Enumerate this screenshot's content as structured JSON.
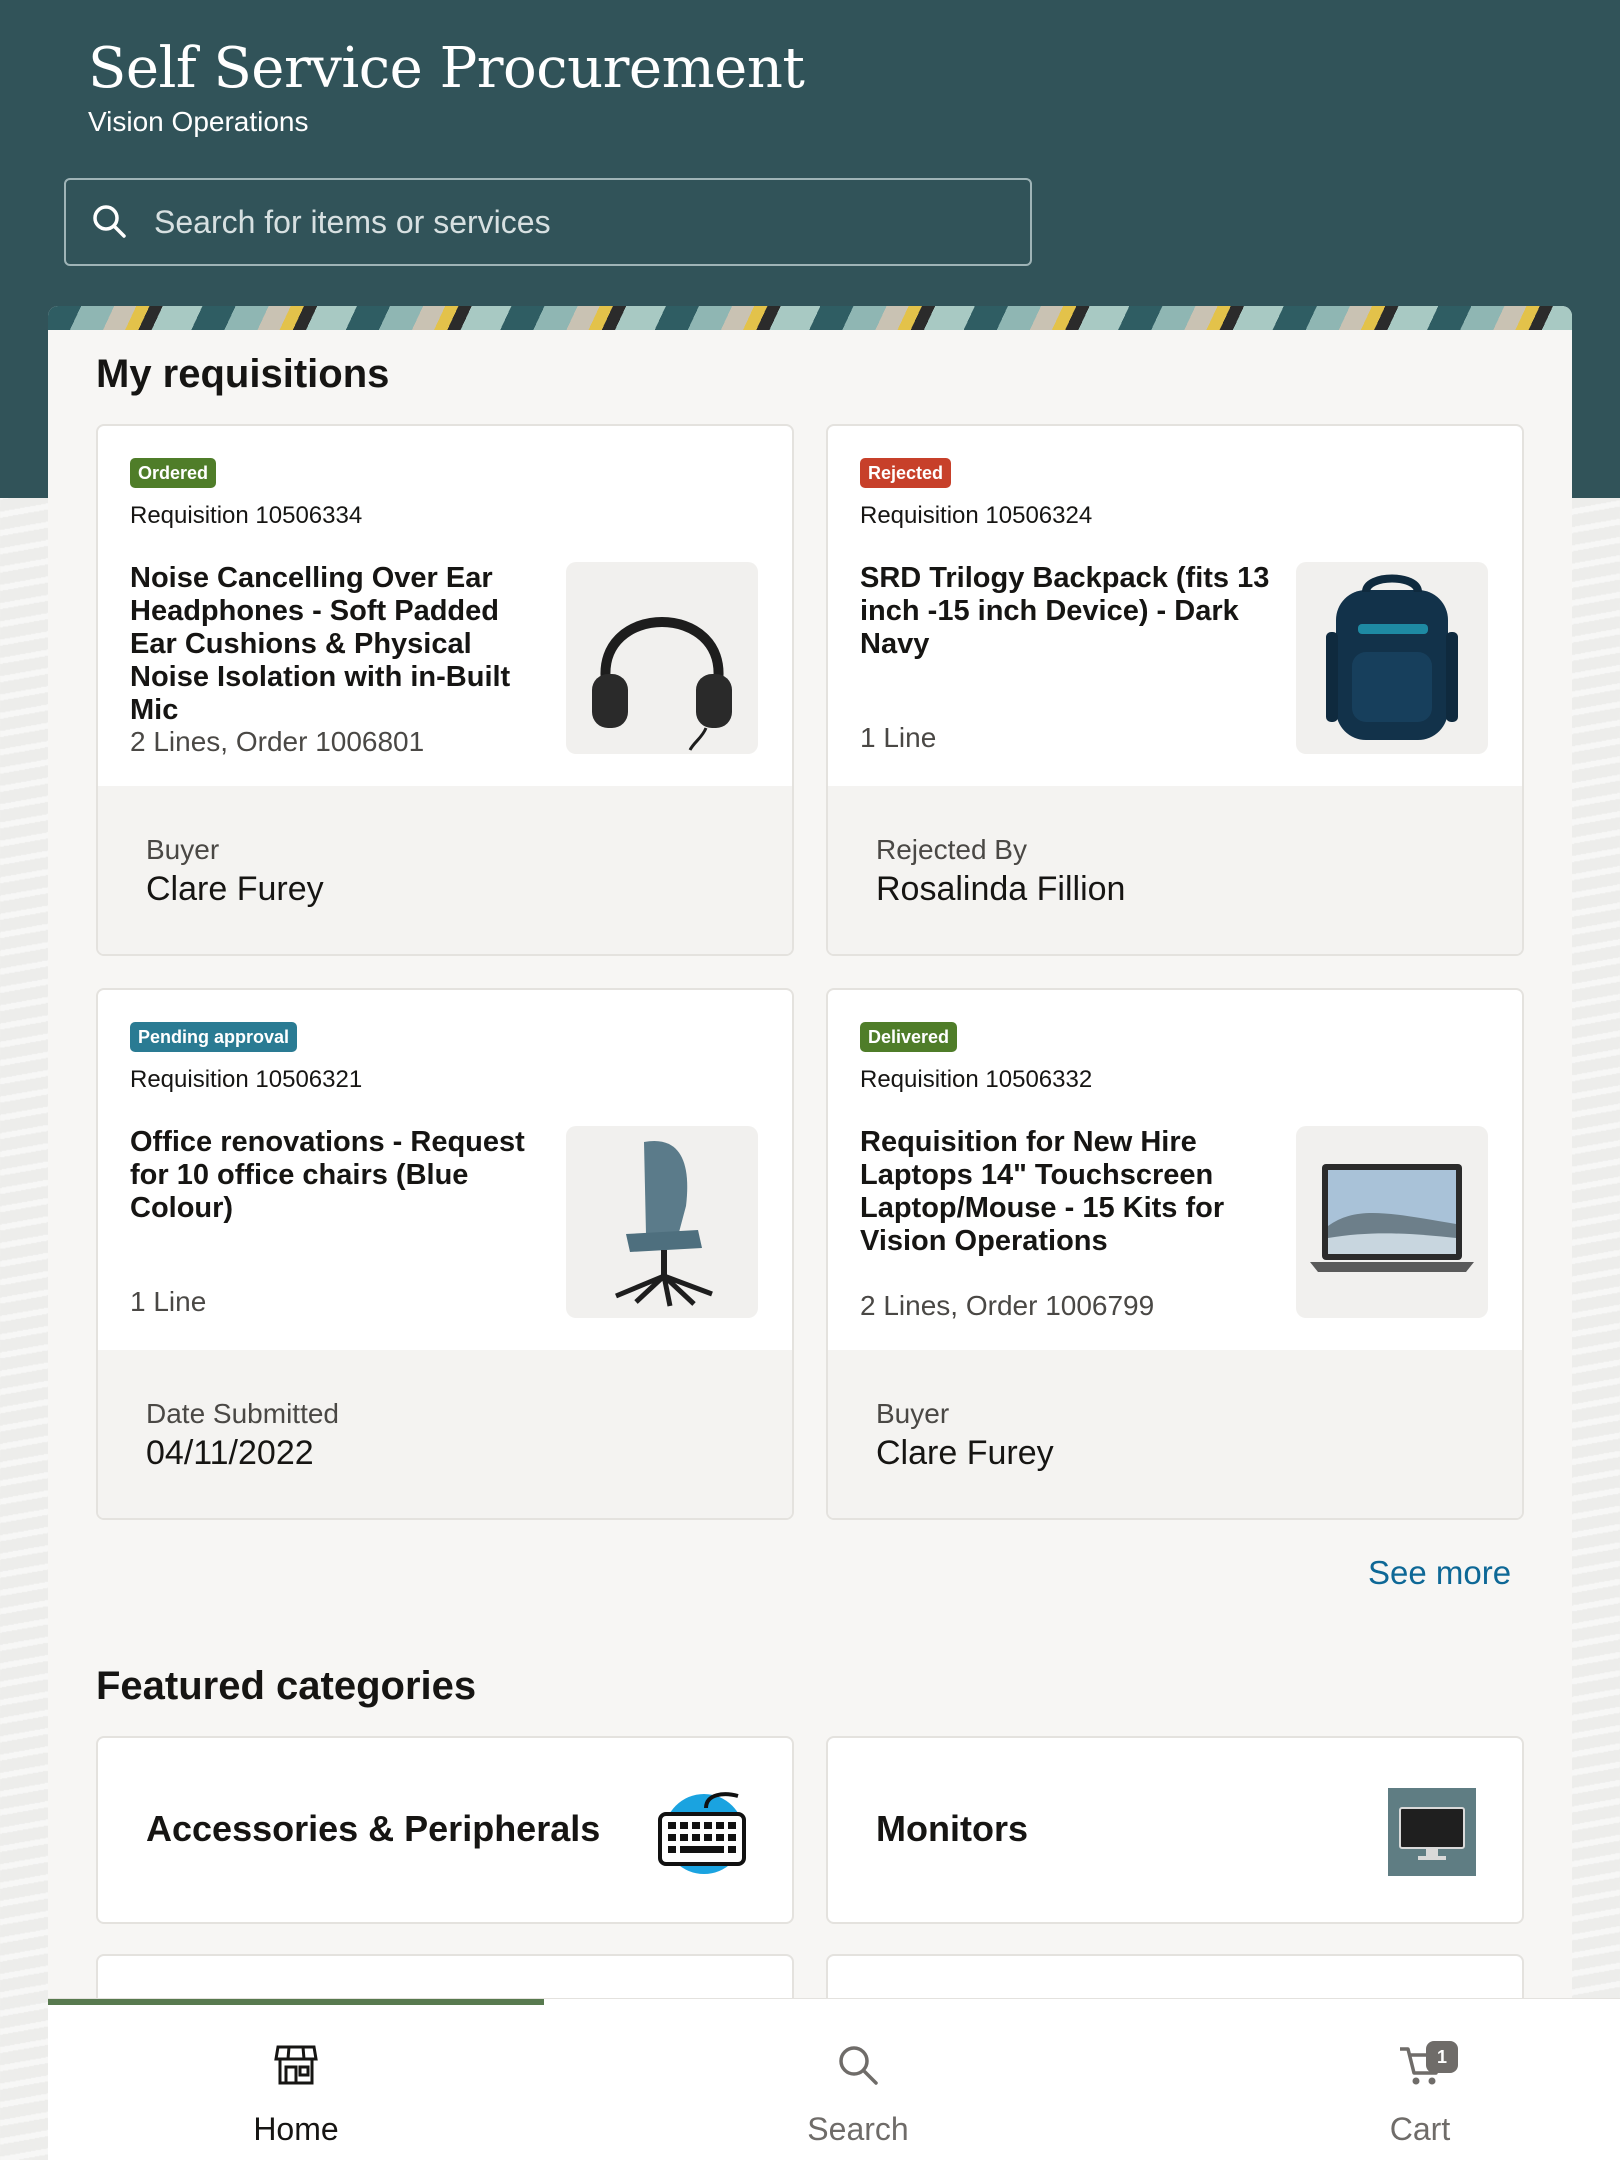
{
  "header": {
    "title": "Self Service Procurement",
    "subtitle": "Vision Operations",
    "search_placeholder": "Search for items or services"
  },
  "my_requisitions": {
    "title": "My requisitions",
    "cards": [
      {
        "status": "Ordered",
        "status_color": "#4f7d29",
        "requisition": "Requisition 10506334",
        "item_title": "Noise Cancelling Over Ear Headphones - Soft Padded Ear Cushions & Physical Noise Isolation with in-Built Mic",
        "lines": "2 Lines, Order 1006801",
        "image": "headphones-image",
        "foot_label": "Buyer",
        "foot_value": "Clare Furey"
      },
      {
        "status": "Rejected",
        "status_color": "#c7402a",
        "requisition": "Requisition 10506324",
        "item_title": "SRD Trilogy Backpack (fits 13 inch -15 inch Device) - Dark Navy",
        "lines": "1 Line",
        "image": "backpack-image",
        "foot_label": "Rejected By",
        "foot_value": "Rosalinda Fillion"
      },
      {
        "status": "Pending approval",
        "status_color": "#2a7b93",
        "requisition": "Requisition 10506321",
        "item_title": "Office renovations - Request for 10 office chairs (Blue Colour)",
        "lines": "1 Line",
        "image": "office-chair-image",
        "foot_label": "Date Submitted",
        "foot_value": "04/11/2022"
      },
      {
        "status": "Delivered",
        "status_color": "#4f7d29",
        "requisition": "Requisition 10506332",
        "item_title": "Requisition for New Hire Laptops 14\" Touchscreen Laptop/Mouse - 15 Kits for Vision Operations",
        "lines": "2 Lines, Order 1006799",
        "image": "laptop-image",
        "foot_label": "Buyer",
        "foot_value": "Clare Furey"
      }
    ],
    "see_more": "See more"
  },
  "featured_categories": {
    "title": "Featured categories",
    "items": [
      {
        "label": "Accessories & Peripherals",
        "icon": "keyboard-icon"
      },
      {
        "label": "Monitors",
        "icon": "monitor-icon"
      }
    ]
  },
  "bottom_nav": {
    "tabs": [
      {
        "label": "Home",
        "icon": "store-icon",
        "active": true
      },
      {
        "label": "Search",
        "icon": "search-icon",
        "active": false
      },
      {
        "label": "Cart",
        "icon": "cart-icon",
        "active": false,
        "count": "1"
      }
    ]
  }
}
